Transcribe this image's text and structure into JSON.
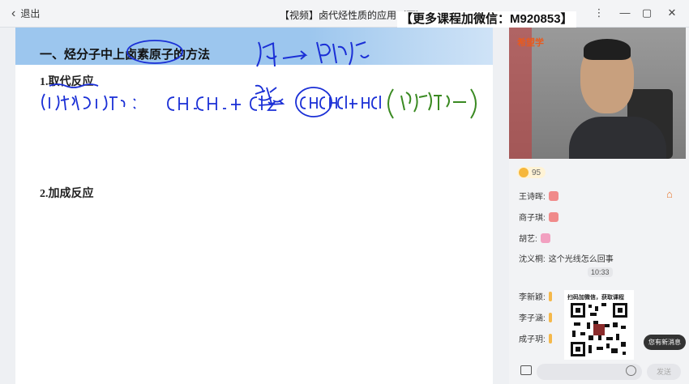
{
  "window": {
    "back_label": "退出",
    "title": "【视频】卤代烃性质的应用（下）",
    "promo": "【更多课程加微信：M920853】"
  },
  "slide": {
    "title": "一、烃分子中上卤素原子的方法",
    "section1": "1.取代反应",
    "section2": "2.加成反应"
  },
  "video": {
    "logo": "希望学"
  },
  "sidebar": {
    "likes": "95",
    "messages": [
      {
        "name": "王诗晖:",
        "text": ""
      },
      {
        "name": "商子琪:",
        "text": ""
      },
      {
        "name": "胡艺:",
        "text": ""
      },
      {
        "name": "沈义桐:",
        "text": "这个光线怎么回事"
      }
    ],
    "time": "10:33",
    "messages2": [
      {
        "name": "李新颖:",
        "text": ""
      },
      {
        "name": "李子涵:",
        "text": ""
      },
      {
        "name": "成子玥:",
        "text": ""
      }
    ],
    "qr_caption": "扫码加微信，获取课程",
    "new_msg": "您有新消息",
    "send": "发送"
  },
  "colors": {
    "accent": "#e85a1e",
    "header": "#9cc6ee",
    "ink_blue": "#1a2fd6",
    "ink_green": "#3a8a22"
  }
}
